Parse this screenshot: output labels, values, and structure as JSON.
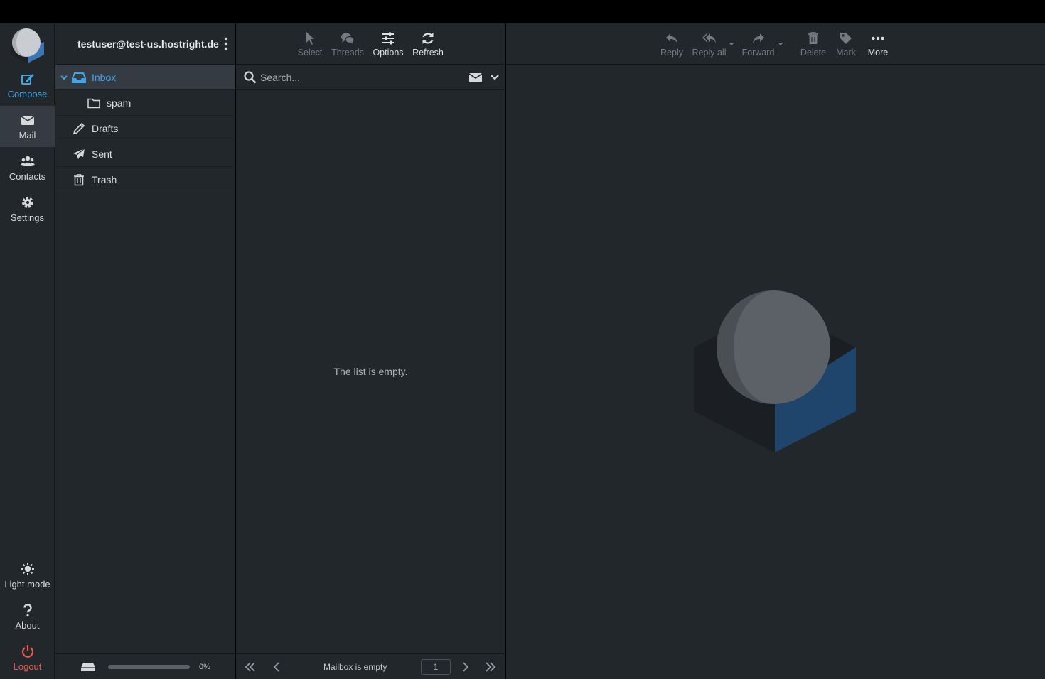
{
  "account": {
    "email": "testuser@test-us.hostright.de"
  },
  "nav": {
    "compose": "Compose",
    "mail": "Mail",
    "contacts": "Contacts",
    "settings": "Settings",
    "light_mode": "Light mode",
    "about": "About",
    "logout": "Logout"
  },
  "folders": [
    {
      "label": "Inbox",
      "icon": "inbox-icon",
      "selected": true
    },
    {
      "label": "spam",
      "icon": "folder-icon"
    },
    {
      "label": "Drafts",
      "icon": "pencil-icon"
    },
    {
      "label": "Sent",
      "icon": "paper-plane-icon"
    },
    {
      "label": "Trash",
      "icon": "trash-icon"
    }
  ],
  "quota": {
    "percent_label": "0%",
    "used_fraction": 0.0
  },
  "list_toolbar": {
    "select": "Select",
    "threads": "Threads",
    "options": "Options",
    "refresh": "Refresh"
  },
  "search": {
    "placeholder": "Search..."
  },
  "message_list": {
    "empty_text": "The list is empty."
  },
  "pager": {
    "status": "Mailbox is empty",
    "page": "1"
  },
  "message_toolbar": {
    "reply": "Reply",
    "reply_all": "Reply all",
    "forward": "Forward",
    "delete": "Delete",
    "mark": "Mark",
    "more": "More"
  },
  "colors": {
    "accent": "#41a5e6",
    "logout": "#e85a4f",
    "panel_bg": "#22272b",
    "selected_bg": "#353b42"
  }
}
